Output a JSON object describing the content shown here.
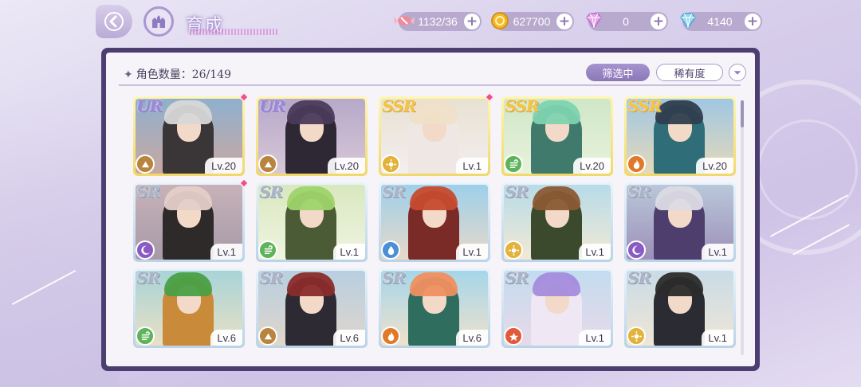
{
  "header": {
    "title": "育成",
    "resources": [
      {
        "name": "candy-icon",
        "value": "1132/36"
      },
      {
        "name": "gold-coin-icon",
        "value": "627700"
      },
      {
        "name": "pink-gem-icon",
        "value": "0"
      },
      {
        "name": "blue-gem-icon",
        "value": "4140"
      }
    ]
  },
  "panel": {
    "count_label": "角色数量：26/149",
    "filter_label": "筛选中",
    "rarity_label": "稀有度"
  },
  "colors": {
    "element_earth": "#b9843e",
    "element_wind": "#5fb35a",
    "element_fire": "#e07a2a",
    "element_water": "#4b8fd6",
    "element_dark": "#8a5bc2",
    "element_red": "#e25a3a",
    "element_yellow": "#e2b23a"
  },
  "cards": [
    {
      "rank": "UR",
      "level": "Lv.20",
      "element": "earth",
      "new": true
    },
    {
      "rank": "UR",
      "level": "Lv.20",
      "element": "earth",
      "new": false
    },
    {
      "rank": "SSR",
      "level": "Lv.1",
      "element": "yellow",
      "new": true
    },
    {
      "rank": "SSR",
      "level": "Lv.20",
      "element": "wind",
      "new": false
    },
    {
      "rank": "SSR",
      "level": "Lv.20",
      "element": "fire",
      "new": false
    },
    {
      "rank": "SR",
      "level": "Lv.1",
      "element": "dark",
      "new": true
    },
    {
      "rank": "SR",
      "level": "Lv.1",
      "element": "wind",
      "new": false
    },
    {
      "rank": "SR",
      "level": "Lv.1",
      "element": "water",
      "new": false
    },
    {
      "rank": "SR",
      "level": "Lv.1",
      "element": "yellow",
      "new": false
    },
    {
      "rank": "SR",
      "level": "Lv.1",
      "element": "dark",
      "new": false
    },
    {
      "rank": "SR",
      "level": "Lv.6",
      "element": "wind",
      "new": false
    },
    {
      "rank": "SR",
      "level": "Lv.6",
      "element": "earth",
      "new": false
    },
    {
      "rank": "SR",
      "level": "Lv.6",
      "element": "fire",
      "new": false
    },
    {
      "rank": "SR",
      "level": "Lv.1",
      "element": "red",
      "new": false
    },
    {
      "rank": "SR",
      "level": "Lv.1",
      "element": "yellow",
      "new": false
    }
  ]
}
